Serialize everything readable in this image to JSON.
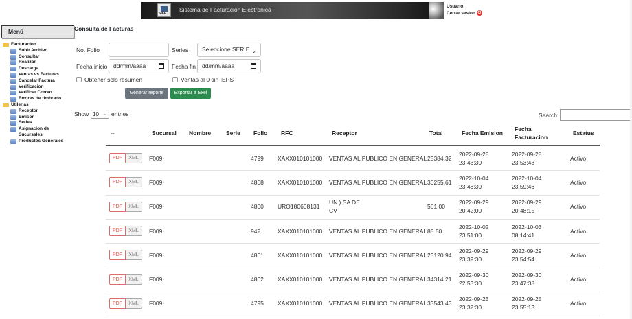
{
  "header": {
    "logo_text": "SIFE",
    "system_title": "Sistema de Facturacion Electronica",
    "user_label": "Usuario:",
    "logout_label": "Cerrar sesion"
  },
  "sidebar": {
    "title": "Menú",
    "groups": [
      {
        "label": "Facturacion",
        "items": [
          {
            "label": "Subir Archivo"
          },
          {
            "label": "Consultar"
          },
          {
            "label": "Realizar"
          },
          {
            "label": "Descarga"
          },
          {
            "label": "Ventas vs Facturas"
          },
          {
            "label": "Cancelar Factura"
          },
          {
            "label": "Verificacion"
          },
          {
            "label": "Verificar Correo"
          },
          {
            "label": "Errores de timbrado"
          }
        ]
      },
      {
        "label": "Utilerias",
        "items": [
          {
            "label": "Receptor"
          },
          {
            "label": "Emisor"
          },
          {
            "label": "Series"
          },
          {
            "label": "Asignacion de Sucursales"
          },
          {
            "label": "Productos Generales"
          }
        ]
      }
    ]
  },
  "main": {
    "title": "Consulta de Facturas",
    "filters": {
      "folio_label": "No. Folio",
      "folio_value": "",
      "series_label": "Series",
      "series_selected": "Seleccione SERIE",
      "fecha_inicio_label": "Fecha inicio",
      "fecha_inicio_value": "dd/mm/aaaa",
      "fecha_fin_label": "Fecha fin",
      "fecha_fin_value": "dd/mm/aaaa",
      "resumen_label": "Obtener solo resumen",
      "ieps_label": "Ventas al 0 sin IEPS"
    },
    "buttons": {
      "report": "Generar reporte",
      "excel": "Exportar a Exel"
    },
    "table_controls": {
      "show": "Show",
      "entries_value": "10",
      "entries": "entries",
      "search_label": "Search:"
    },
    "table": {
      "columns": [
        "--",
        "Sucursal",
        "Nombre",
        "Serie",
        "Folio",
        "RFC",
        "Receptor",
        "Total",
        "Fecha Emision",
        "Fecha Facturacion",
        "Estatus"
      ],
      "pdf_label": "PDF",
      "xml_label": "XML",
      "rows": [
        {
          "sucursal": "F009·",
          "folio": "4799",
          "rfc": "XAXX010101000",
          "receptor": [
            "VENTAS AL PUBLICO EN GENERAL"
          ],
          "total": "25384.32",
          "emision": [
            "2022-09-28",
            "23:43:30"
          ],
          "facturacion": [
            "2022-09-28",
            "23:53:43"
          ],
          "estatus": "Activo"
        },
        {
          "sucursal": "F009·",
          "folio": "4808",
          "rfc": "XAXX010101000",
          "receptor": [
            "VENTAS AL PUBLICO EN GENERAL"
          ],
          "total": "30255.61",
          "emision": [
            "2022-10-04",
            "23:46:30"
          ],
          "facturacion": [
            "2022-10-04",
            "23:59:46"
          ],
          "estatus": "Activo"
        },
        {
          "sucursal": "F009·",
          "folio": "4800",
          "rfc": "URO180608131",
          "receptor": [
            "UN                    ) SA DE",
            "CV"
          ],
          "total": "561.00",
          "emision": [
            "2022-09-29",
            "20:42:00"
          ],
          "facturacion": [
            "2022-09-29",
            "20:48:15"
          ],
          "estatus": "Activo"
        },
        {
          "sucursal": "F009·",
          "folio": "942",
          "rfc": "XAXX010101000",
          "receptor": [
            "VENTAS AL PUBLICO EN GENERAL"
          ],
          "total": "85.50",
          "emision": [
            "2022-10-02",
            "23:51:00"
          ],
          "facturacion": [
            "2022-10-03",
            "08:14:41"
          ],
          "estatus": "Activo"
        },
        {
          "sucursal": "F009·",
          "folio": "4801",
          "rfc": "XAXX010101000",
          "receptor": [
            "VENTAS AL PUBLICO EN GENERAL"
          ],
          "total": "23120.94",
          "emision": [
            "2022-09-29",
            "23:39:30"
          ],
          "facturacion": [
            "2022-09-29",
            "23:54:54"
          ],
          "estatus": "Activo"
        },
        {
          "sucursal": "F009·",
          "folio": "4802",
          "rfc": "XAXX010101000",
          "receptor": [
            "VENTAS AL PUBLICO EN GENERAL"
          ],
          "total": "34314.21",
          "emision": [
            "2022-09-30",
            "22:53:30"
          ],
          "facturacion": [
            "2022-09-30",
            "23:47:38"
          ],
          "estatus": "Activo"
        },
        {
          "sucursal": "F009·",
          "folio": "4795",
          "rfc": "XAXX010101000",
          "receptor": [
            "VENTAS AL PUBLICO EN GENERAL"
          ],
          "total": "33543.43",
          "emision": [
            "2022-09-25",
            "23:32:30"
          ],
          "facturacion": [
            "2022-09-25",
            "23:55:13"
          ],
          "estatus": "Activo"
        }
      ]
    }
  }
}
